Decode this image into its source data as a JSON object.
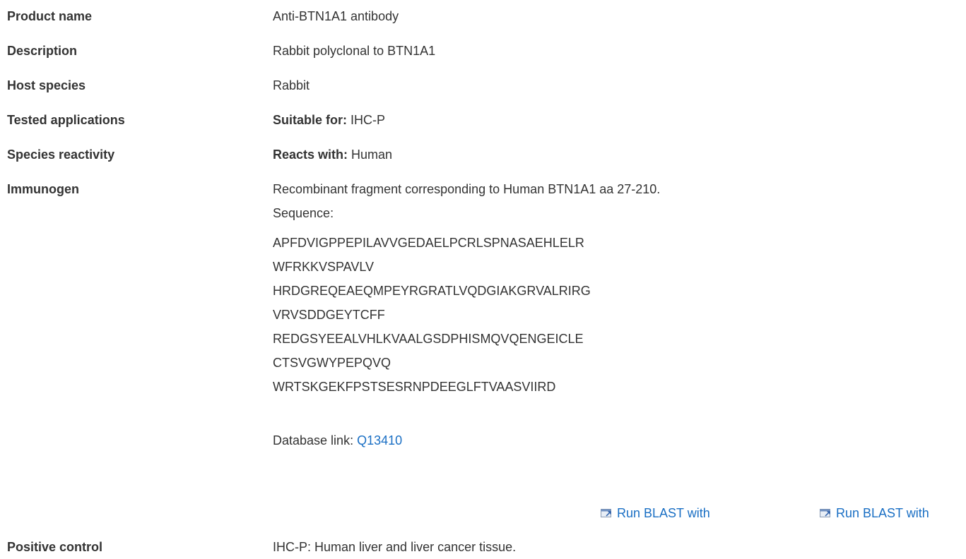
{
  "rows": {
    "product_name": {
      "label": "Product name",
      "value": "Anti-BTN1A1 antibody"
    },
    "description": {
      "label": "Description",
      "value": "Rabbit polyclonal to BTN1A1"
    },
    "host_species": {
      "label": "Host species",
      "value": "Rabbit"
    },
    "tested_applications": {
      "label": "Tested applications",
      "prefix": "Suitable for:",
      "value": " IHC-P"
    },
    "species_reactivity": {
      "label": "Species reactivity",
      "prefix": "Reacts with:",
      "value": " Human"
    },
    "immunogen": {
      "label": "Immunogen",
      "text": "Recombinant fragment corresponding to Human BTN1A1 aa 27-210.",
      "sequence_label": "Sequence:",
      "sequence_lines": [
        "APFDVIGPPEPILAVVGEDAELPCRLSPNASAEHLELR",
        "WFRKKVSPAVLV",
        "HRDGREQEAEQMPEYRGRATLVQDGIAKGRVALRIRG",
        "VRVSDDGEYTCFF",
        "REDGSYEEALVHLKVAALGSDPHISMQVQENGEICLE",
        "CTSVGWYPEPQVQ",
        "WRTSKGEKFPSTSESRNPDEEGLFTVAASVIIRD"
      ],
      "db_link_label": "Database link: ",
      "db_link_value": "Q13410"
    },
    "blast": {
      "link1": "Run BLAST with",
      "link2": "Run BLAST with",
      "icon": "external-link-icon"
    },
    "positive_control": {
      "label": "Positive control",
      "value": "IHC-P: Human liver and liver cancer tissue."
    }
  },
  "colors": {
    "link": "#1a6fc4",
    "text": "#333333"
  }
}
